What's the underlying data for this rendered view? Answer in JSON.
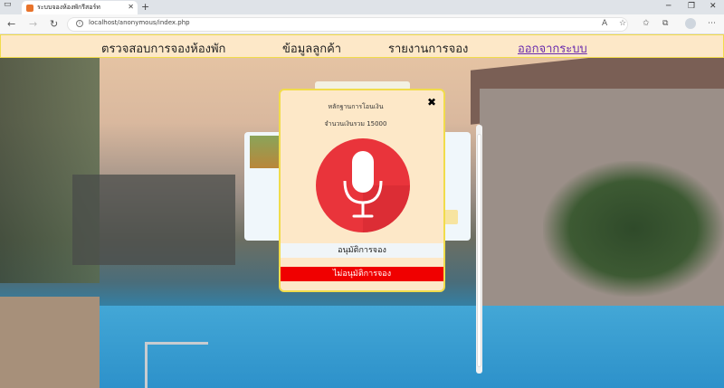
{
  "browser": {
    "tab_title": "ระบบจองห้องพักรีสอร์ท",
    "url": "localhost/anonymous/index.php",
    "new_tab_symbol": "+",
    "tab_close_symbol": "✕"
  },
  "navbar": {
    "items": [
      {
        "label": "ตรวจสอบการจองห้องพัก"
      },
      {
        "label": "ข้อมูลลูกค้า"
      },
      {
        "label": "รายงานการจอง"
      },
      {
        "label": "ออกจากระบบ"
      }
    ]
  },
  "modal": {
    "title": "หลักฐานการโอนเงิน",
    "amount_text": "จำนวนเงินรวม 15000",
    "close_symbol": "✖",
    "image_icon": "microphone-icon",
    "approve_label": "อนุมัติการจอง",
    "reject_label": "ไม่อนุมัติการจอง",
    "colors": {
      "background": "#fde8c8",
      "border": "#f1dc4b",
      "reject": "#f00000",
      "mic_circle": "#e9343b"
    }
  }
}
